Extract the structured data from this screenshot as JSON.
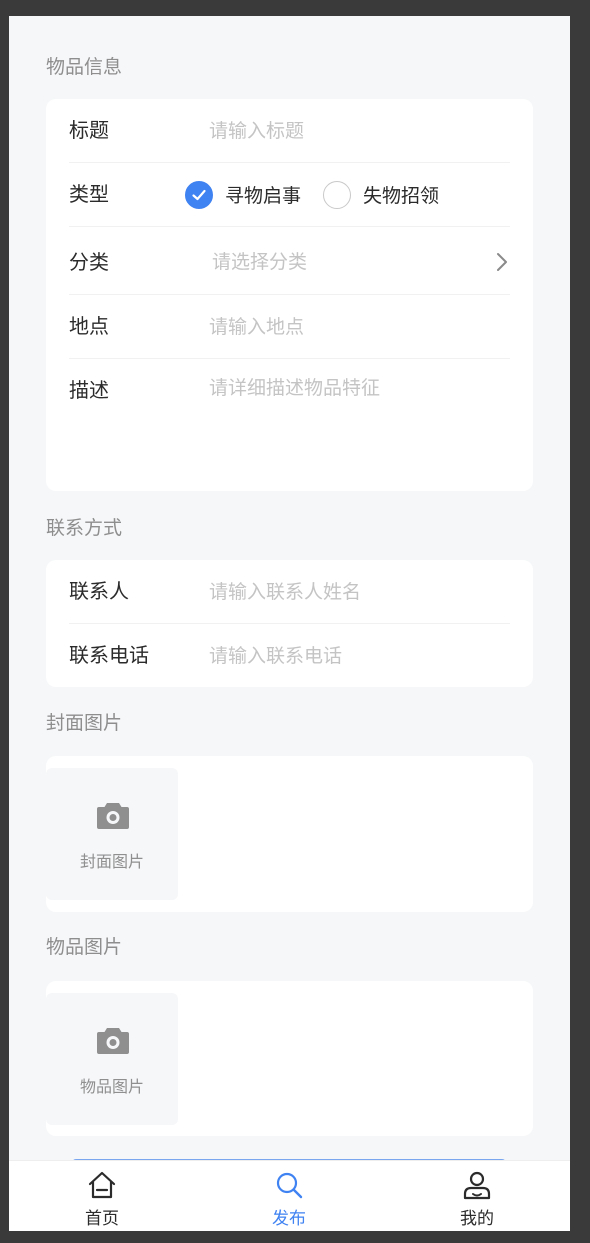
{
  "sections": {
    "item_info": "物品信息",
    "contact": "联系方式",
    "cover": "封面图片",
    "item_images": "物品图片"
  },
  "form": {
    "title": {
      "label": "标题",
      "placeholder": "请输入标题"
    },
    "type": {
      "label": "类型",
      "options": [
        {
          "label": "寻物启事",
          "checked": true
        },
        {
          "label": "失物招领",
          "checked": false
        }
      ]
    },
    "category": {
      "label": "分类",
      "placeholder": "请选择分类"
    },
    "location": {
      "label": "地点",
      "placeholder": "请输入地点"
    },
    "description": {
      "label": "描述",
      "placeholder": "请详细描述物品特征"
    },
    "contact_name": {
      "label": "联系人",
      "placeholder": "请输入联系人姓名"
    },
    "contact_phone": {
      "label": "联系电话",
      "placeholder": "请输入联系电话"
    }
  },
  "uploads": {
    "cover_label": "封面图片",
    "item_label": "物品图片"
  },
  "tabbar": {
    "items": [
      {
        "label": "首页",
        "icon": "home-icon",
        "active": false
      },
      {
        "label": "发布",
        "icon": "search-icon",
        "active": true
      },
      {
        "label": "我的",
        "icon": "user-icon",
        "active": false
      }
    ]
  },
  "colors": {
    "accent": "#3f82f2",
    "background": "#f6f7f9",
    "placeholder": "#c4c4c4"
  }
}
